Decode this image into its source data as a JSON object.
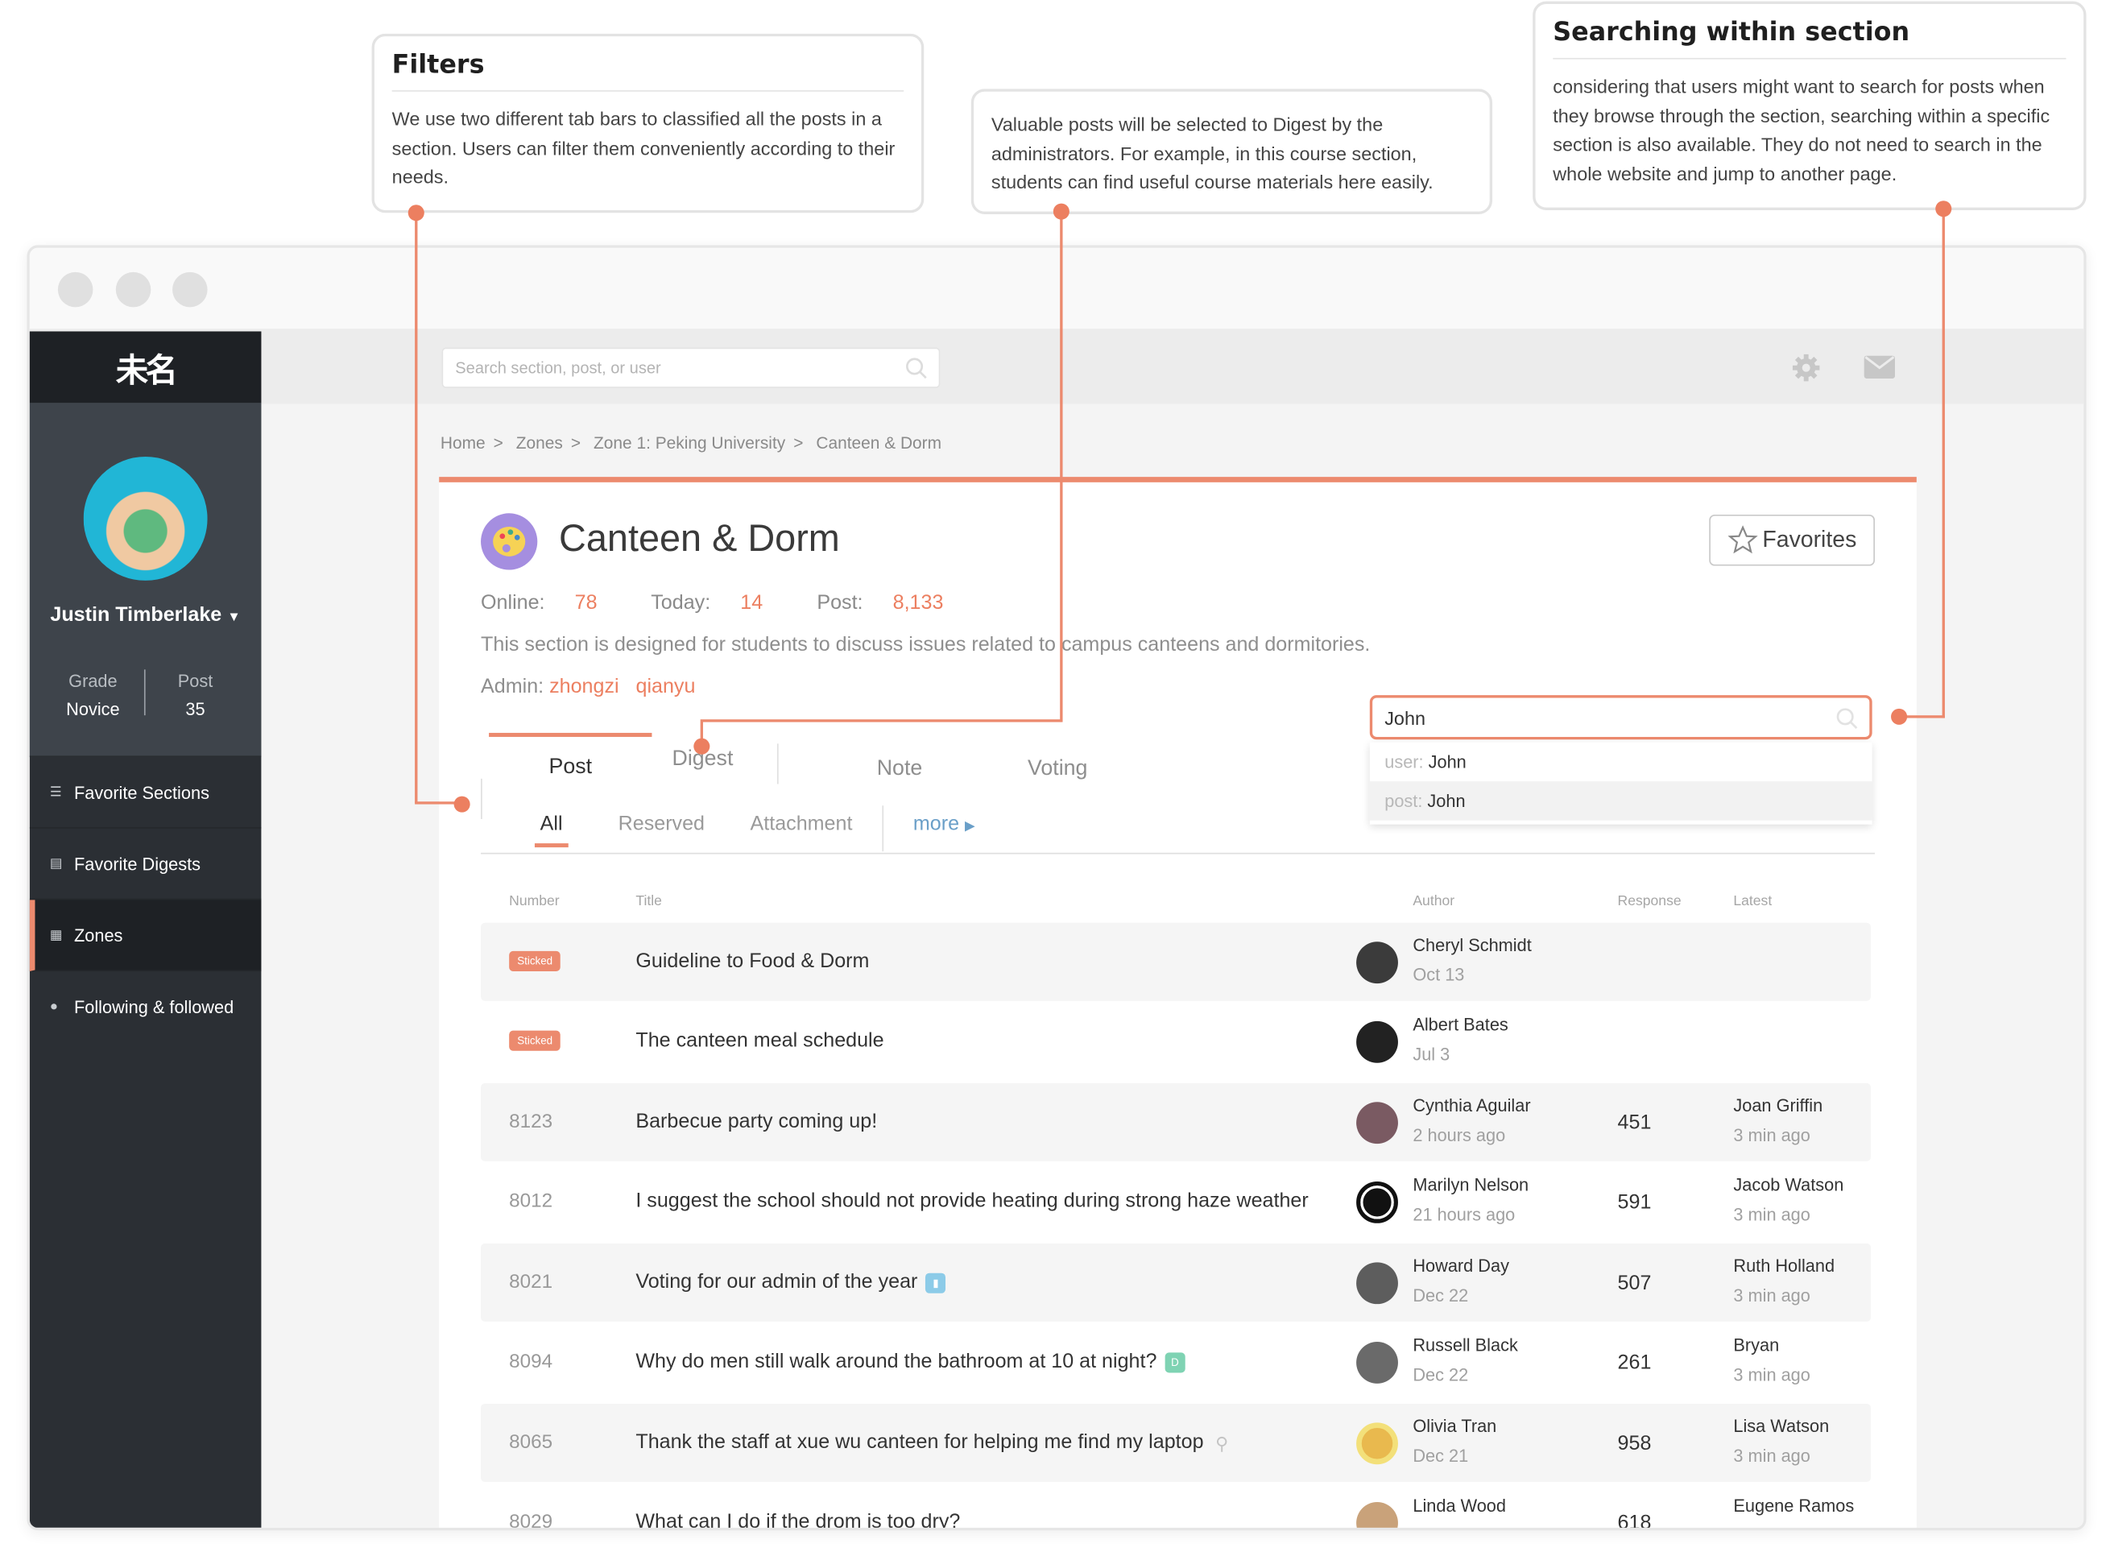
{
  "annotations": {
    "filters": {
      "title": "Filters",
      "text": "We use two different tab bars to classified all the posts in a section. Users can filter them conveniently according to their needs."
    },
    "digest": {
      "text": "Valuable posts will be selected to Digest by the administrators. For example, in this course section, students can find useful course materials here easily."
    },
    "search": {
      "title": "Searching within section",
      "text": "considering that users might want to search for posts when they browse through the section, searching within a specific section is also available. They do not need to search in the whole website and jump to another page."
    }
  },
  "app": {
    "logo": "未名",
    "search_placeholder": "Search section, post, or user"
  },
  "user": {
    "name": "Justin Timberlake",
    "grade_label": "Grade",
    "grade": "Novice",
    "post_label": "Post",
    "post_count": "35"
  },
  "nav": [
    "Favorite Sections",
    "Favorite Digests",
    "Zones",
    "Following & followed"
  ],
  "breadcrumb": [
    "Home",
    ">",
    "Zones",
    ">",
    "Zone 1: Peking University",
    ">",
    "Canteen & Dorm"
  ],
  "section": {
    "title": "Canteen & Dorm",
    "favorites_label": "Favorites",
    "online_label": "Online:",
    "online": "78",
    "today_label": "Today:",
    "today": "14",
    "post_label": "Post:",
    "post": "8,133",
    "description": "This section is designed for students to discuss issues related to campus canteens and dormitories.",
    "admin_label": "Admin:",
    "admins": [
      "zhongzi",
      "qianyu"
    ]
  },
  "section_search": {
    "value": "John",
    "suggestions": [
      {
        "type": "user:",
        "text": "John"
      },
      {
        "type": "post:",
        "text": "John"
      }
    ]
  },
  "tabs": [
    "Post",
    "Digest",
    "Note",
    "Voting"
  ],
  "subtabs": [
    "All",
    "Reserved",
    "Attachment",
    "more"
  ],
  "columns": [
    "Number",
    "Title",
    "Author",
    "Response",
    "Latest"
  ],
  "rows": [
    {
      "number": "",
      "badge": "Sticked",
      "title": "Guideline to Food & Dorm",
      "author": "Cheryl Schmidt",
      "date": "Oct 13",
      "response": "",
      "latest_user": "",
      "latest_time": ""
    },
    {
      "number": "",
      "badge": "Sticked",
      "title": "The canteen meal schedule",
      "author": "Albert Bates",
      "date": "Jul 3",
      "response": "",
      "latest_user": "",
      "latest_time": ""
    },
    {
      "number": "8123",
      "badge": "",
      "title": "Barbecue party coming up!",
      "author": "Cynthia Aguilar",
      "date": "2 hours ago",
      "response": "451",
      "latest_user": "Joan Griffin",
      "latest_time": "3 min ago"
    },
    {
      "number": "8012",
      "badge": "",
      "title": "I suggest the school should not provide heating during strong haze weather",
      "author": "Marilyn Nelson",
      "date": "21 hours ago",
      "response": "591",
      "latest_user": "Jacob Watson",
      "latest_time": "3 min ago"
    },
    {
      "number": "8021",
      "badge": "",
      "title": "Voting for our admin of the year",
      "author": "Howard Day",
      "date": "Dec 22",
      "response": "507",
      "latest_user": "Ruth Holland",
      "latest_time": "3 min ago"
    },
    {
      "number": "8094",
      "badge": "",
      "title": "Why do men still walk around the bathroom at 10 at night?",
      "author": "Russell Black",
      "date": "Dec 22",
      "response": "261",
      "latest_user": "Bryan",
      "latest_time": "3 min ago"
    },
    {
      "number": "8065",
      "badge": "",
      "title": "Thank the staff at xue wu canteen for helping me find my laptop",
      "author": "Olivia Tran",
      "date": "Dec 21",
      "response": "958",
      "latest_user": "Lisa Watson",
      "latest_time": "3 min ago"
    },
    {
      "number": "8029",
      "badge": "",
      "title": "What can I do if the drom is too dry?",
      "author": "Linda Wood",
      "date": "",
      "response": "618",
      "latest_user": "Eugene Ramos",
      "latest_time": ""
    }
  ],
  "colors": {
    "accent": "#ec8a6e",
    "sidebar": "#2b2f34",
    "sidebar_dark": "#1e2125"
  }
}
